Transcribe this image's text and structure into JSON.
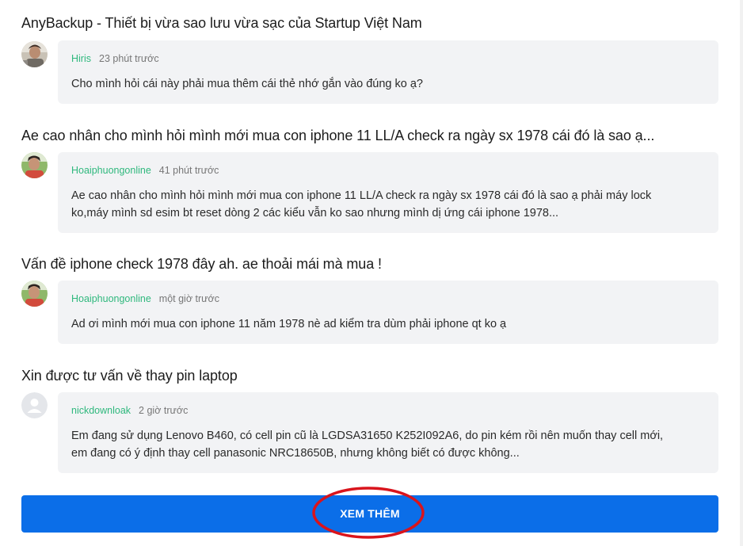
{
  "threads": [
    {
      "title": "AnyBackup - Thiết bị vừa sao lưu vừa sạc của Startup Việt Nam",
      "author": "Hiris",
      "time": "23 phút trước",
      "lines": [
        "Cho mình hỏi cái này phải mua thêm cái thẻ nhớ gắn vào đúng ko ạ?"
      ],
      "avatar": "photo-avatar"
    },
    {
      "title": "Ae cao nhân cho mình hỏi mình mới mua con iphone 11 LL/A check ra ngày sx 1978 cái đó là sao ạ...",
      "author": "Hoaiphuongonline",
      "time": "41 phút trước",
      "lines": [
        "Ae cao nhân cho mình hỏi mình mới mua con iphone 11 LL/A check ra ngày sx 1978 cái đó là sao ạ phải máy lock",
        "ko,máy mình sd esim bt reset dòng 2 các kiểu vẫn ko sao nhưng mình dị ứng cái iphone 1978..."
      ],
      "avatar": "photo-avatar"
    },
    {
      "title": "Vấn đề iphone check 1978 đây ah. ae thoải mái mà mua !",
      "author": "Hoaiphuongonline",
      "time": "một giờ trước",
      "lines": [
        "Ad ơi mình mới mua con iphone 11 năm 1978 nè ad kiểm tra dùm phải iphone qt ko ạ"
      ],
      "avatar": "photo-avatar"
    },
    {
      "title": "Xin được tư vấn về thay pin laptop",
      "author": "nickdownloak",
      "time": "2 giờ trước",
      "lines": [
        "Em đang sử dụng Lenovo B460, có cell pin cũ là LGDSA31650 K252I092A6, do pin kém rồi nên muốn thay cell mới,",
        "em đang có ý định thay cell panasonic NRC18650B, nhưng không biết có được không..."
      ],
      "avatar": "default-user-icon"
    }
  ],
  "more_button": {
    "label": "XEM THÊM"
  },
  "colors": {
    "author": "#2fb87d",
    "button": "#0b6ee8",
    "bubble": "#f2f3f5",
    "highlight": "#d9141c"
  }
}
